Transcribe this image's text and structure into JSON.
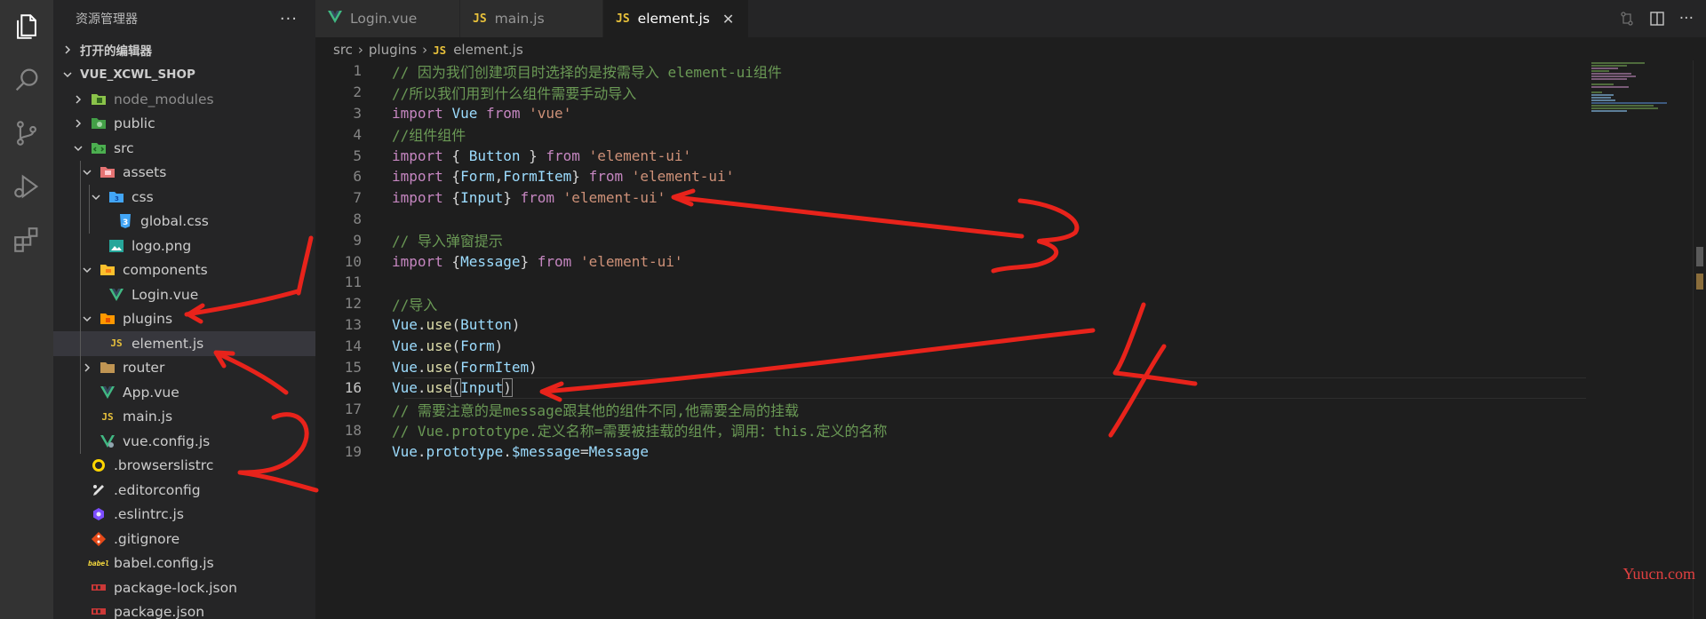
{
  "activity_bar": {
    "icons": [
      "explorer-icon",
      "search-icon",
      "source-control-icon",
      "run-debug-icon",
      "extensions-icon"
    ]
  },
  "sidebar": {
    "title": "资源管理器",
    "more": "···",
    "open_editors_label": "打开的编辑器",
    "project_label": "VUE_XCWL_SHOP",
    "tree": [
      {
        "label": "node_modules"
      },
      {
        "label": "public"
      },
      {
        "label": "src"
      },
      {
        "label": "assets"
      },
      {
        "label": "css"
      },
      {
        "label": "global.css"
      },
      {
        "label": "logo.png"
      },
      {
        "label": "components"
      },
      {
        "label": "Login.vue"
      },
      {
        "label": "plugins"
      },
      {
        "label": "element.js"
      },
      {
        "label": "router"
      },
      {
        "label": "App.vue"
      },
      {
        "label": "main.js"
      },
      {
        "label": "vue.config.js"
      },
      {
        "label": ".browserslistrc"
      },
      {
        "label": ".editorconfig"
      },
      {
        "label": ".eslintrc.js"
      },
      {
        "label": ".gitignore"
      },
      {
        "label": "babel.config.js"
      },
      {
        "label": "package-lock.json"
      },
      {
        "label": "package.json"
      }
    ]
  },
  "tabs": [
    {
      "label": "Login.vue",
      "icon": "V"
    },
    {
      "label": "main.js",
      "icon": "JS"
    },
    {
      "label": "element.js",
      "icon": "JS",
      "close": "✕"
    }
  ],
  "breadcrumb": {
    "part1": "src",
    "part2": "plugins",
    "js_icon": "JS",
    "part3": "element.js"
  },
  "editor": {
    "line_numbers": [
      "1",
      "2",
      "3",
      "4",
      "5",
      "6",
      "7",
      "8",
      "9",
      "10",
      "11",
      "12",
      "13",
      "14",
      "15",
      "16",
      "17",
      "18",
      "19"
    ],
    "current_line": 16
  },
  "annotations": {
    "n1": "1",
    "n2": "2",
    "n3": "3",
    "n4": "4"
  },
  "watermark": "Yuucn.com",
  "colors": {
    "comment": "#6a9955",
    "keyword": "#c586c0",
    "string": "#ce9178",
    "variable": "#9cdcfe",
    "annotation_red": "#e8231b"
  }
}
